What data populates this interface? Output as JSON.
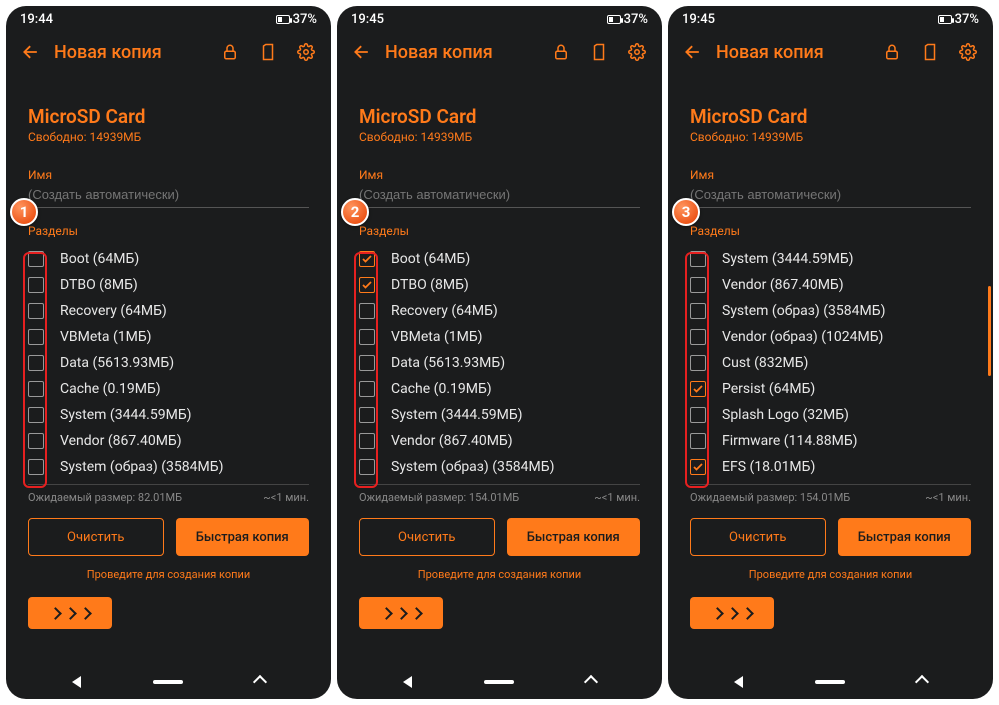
{
  "statusbar": {
    "time": "19:44",
    "time2": "19:45",
    "time3": "19:45",
    "battery": "37%"
  },
  "appbar": {
    "title": "Новая копия"
  },
  "storage": {
    "title": "MicroSD Card",
    "free": "Свободно: 14939МБ"
  },
  "name": {
    "label": "Имя",
    "placeholder": "(Создать автоматически)"
  },
  "sections_label": "Разделы",
  "est": {
    "label1": "Ожидаемый размер:  82.01МБ",
    "label2": "Ожидаемый размер:  154.01МБ",
    "label3": "Ожидаемый размер:  154.01МБ",
    "time": "~<1 мин."
  },
  "buttons": {
    "clear": "Очистить",
    "quick": "Быстрая копия"
  },
  "hint": "Проведите для создания копии",
  "screens": [
    {
      "badge": "1",
      "partitions": [
        {
          "label": "Boot (64МБ)",
          "checked": false
        },
        {
          "label": "DTBO (8МБ)",
          "checked": false
        },
        {
          "label": "Recovery (64МБ)",
          "checked": false
        },
        {
          "label": "VBMeta (1МБ)",
          "checked": false
        },
        {
          "label": "Data (5613.93МБ)",
          "checked": false
        },
        {
          "label": "Cache (0.19МБ)",
          "checked": false
        },
        {
          "label": "System (3444.59МБ)",
          "checked": false
        },
        {
          "label": "Vendor (867.40МБ)",
          "checked": false
        },
        {
          "label": "System (образ) (3584МБ)",
          "checked": false
        }
      ]
    },
    {
      "badge": "2",
      "partitions": [
        {
          "label": "Boot (64МБ)",
          "checked": true
        },
        {
          "label": "DTBO (8МБ)",
          "checked": true
        },
        {
          "label": "Recovery (64МБ)",
          "checked": false
        },
        {
          "label": "VBMeta (1МБ)",
          "checked": false
        },
        {
          "label": "Data (5613.93МБ)",
          "checked": false
        },
        {
          "label": "Cache (0.19МБ)",
          "checked": false
        },
        {
          "label": "System (3444.59МБ)",
          "checked": false
        },
        {
          "label": "Vendor (867.40МБ)",
          "checked": false
        },
        {
          "label": "System (образ) (3584МБ)",
          "checked": false
        }
      ]
    },
    {
      "badge": "3",
      "partitions": [
        {
          "label": "System (3444.59МБ)",
          "checked": false
        },
        {
          "label": "Vendor (867.40МБ)",
          "checked": false
        },
        {
          "label": "System (образ) (3584МБ)",
          "checked": false
        },
        {
          "label": "Vendor (образ) (1024МБ)",
          "checked": false
        },
        {
          "label": "Cust (832МБ)",
          "checked": false
        },
        {
          "label": "Persist (64МБ)",
          "checked": true
        },
        {
          "label": "Splash Logo (32МБ)",
          "checked": false
        },
        {
          "label": "Firmware (114.88МБ)",
          "checked": false
        },
        {
          "label": "EFS (18.01МБ)",
          "checked": true
        }
      ]
    }
  ]
}
